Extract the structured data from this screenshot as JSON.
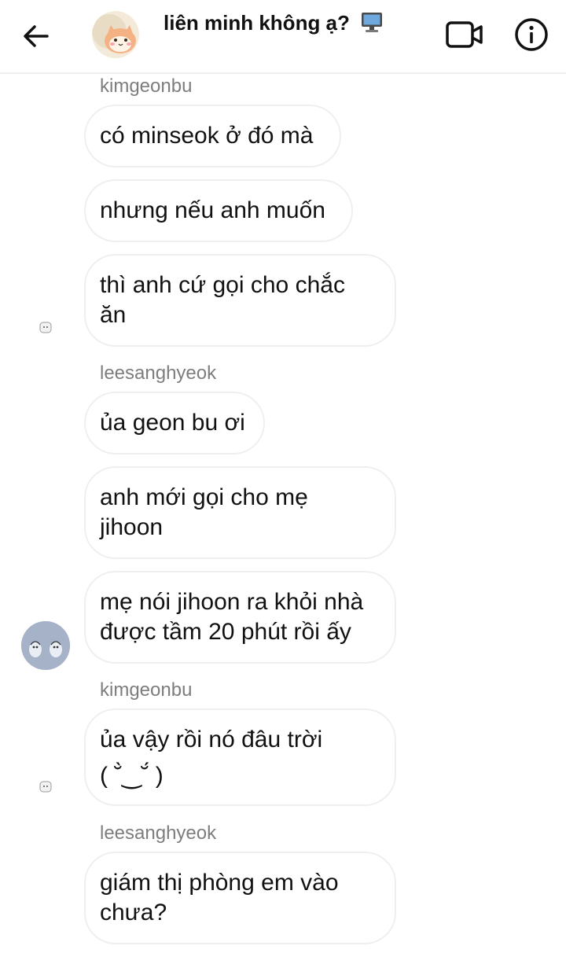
{
  "header": {
    "title": "liên minh không ạ?",
    "icons": {
      "back": "arrow-left-icon",
      "avatar": "hamster-avatar",
      "title_emoji": "computer-icon",
      "video": "video-camera-icon",
      "info": "info-icon"
    }
  },
  "messages": [
    {
      "sender": "kimgeonbu",
      "lines": [
        "có minseok ở đó mà"
      ]
    },
    {
      "lines": [
        "nhưng nếu anh muốn"
      ]
    },
    {
      "lines": [
        "thì anh cứ gọi cho chắc",
        "ăn"
      ]
    },
    {
      "sender": "leesanghyeok",
      "lines": [
        "ủa geon bu ơi"
      ]
    },
    {
      "lines": [
        "anh mới gọi cho mẹ",
        "jihoon"
      ]
    },
    {
      "lines": [
        "mẹ nói jihoon ra khỏi nhà",
        "được tầm 20 phút rồi ấy"
      ]
    },
    {
      "sender": "kimgeonbu",
      "lines": [
        "ủa vậy rồi nó đâu trời",
        "( ˘̀‿˘́ )"
      ]
    },
    {
      "sender": "leesanghyeok",
      "lines": [
        "giám thị phòng em vào",
        "chưa?"
      ]
    }
  ],
  "colors": {
    "background": "#ffffff",
    "bubble_border": "#efefef",
    "sender_text": "#7d7d7d",
    "avatar_blue": "#a6b2c8"
  }
}
